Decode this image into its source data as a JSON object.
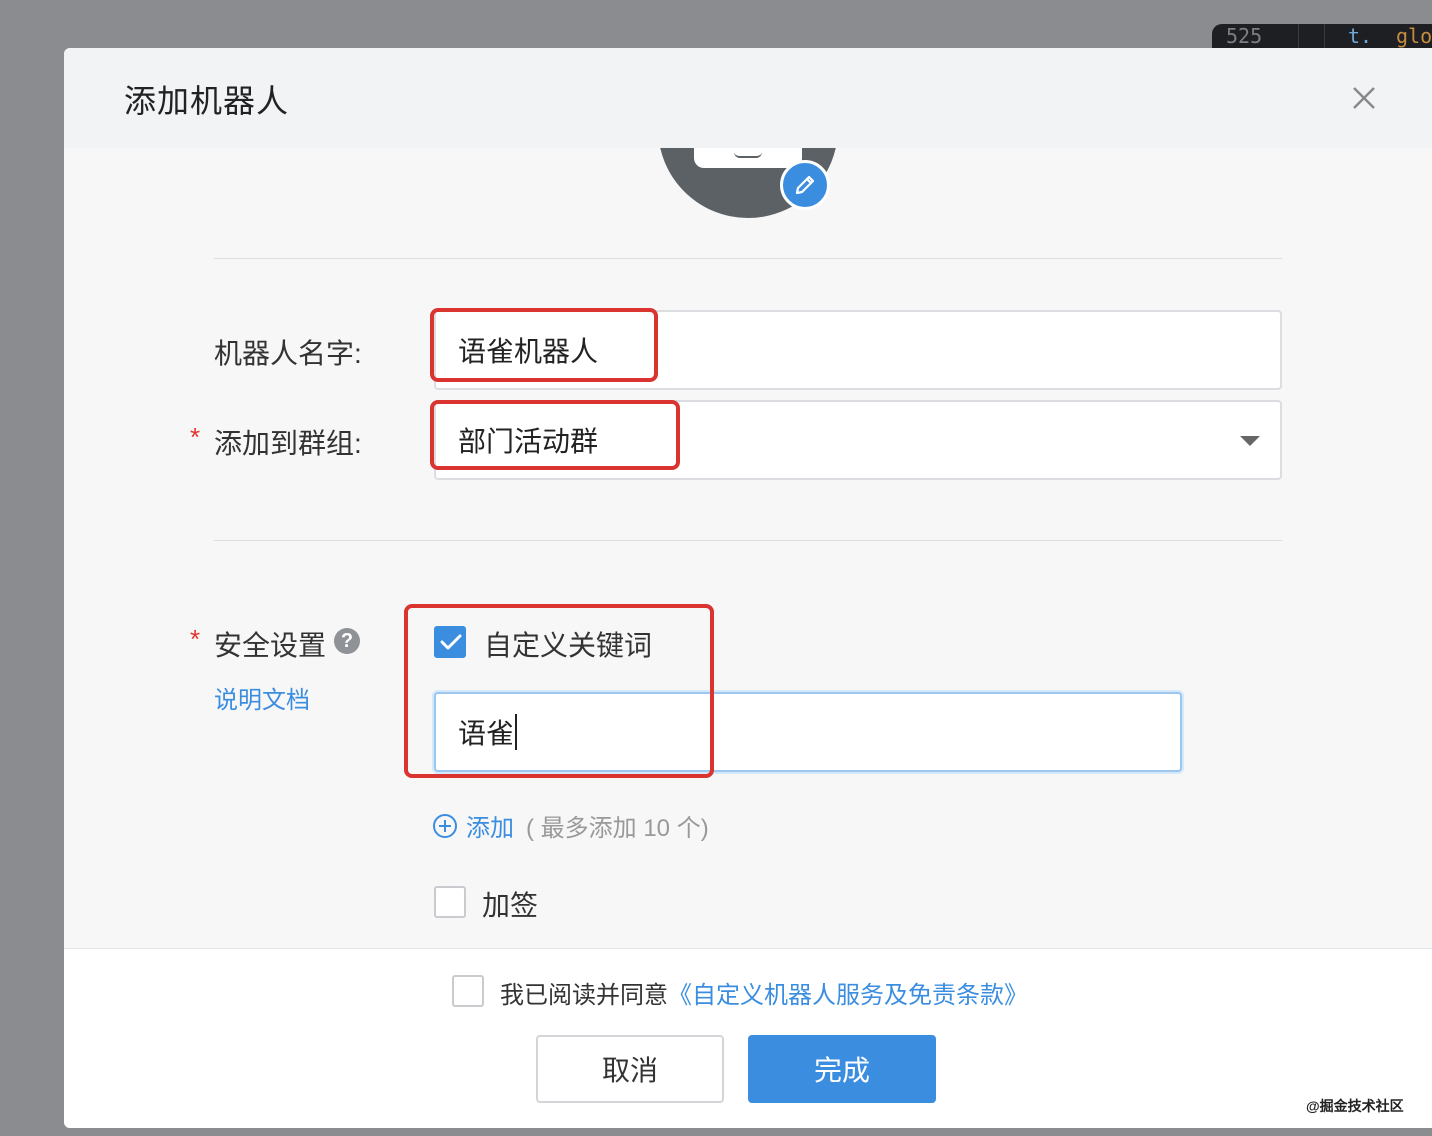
{
  "background_code": {
    "col1": "525",
    "col2": "t.",
    "col3": "glo"
  },
  "dialog": {
    "title": "添加机器人"
  },
  "form": {
    "name_label": "机器人名字:",
    "name_value": "语雀机器人",
    "group_label": "添加到群组:",
    "group_value": "部门活动群",
    "security_label": "安全设置",
    "doc_link": "说明文档",
    "keyword_option": "自定义关键词",
    "keyword_checked": true,
    "keyword_value": "语雀",
    "add_label": "添加",
    "add_note": "( 最多添加 10 个)",
    "sign_option": "加签",
    "sign_checked": false
  },
  "footer": {
    "agree_prefix": "我已阅读并同意",
    "agree_link": "《自定义机器人服务及免责条款》",
    "cancel_label": "取消",
    "confirm_label": "完成"
  },
  "watermark": "@掘金技术社区",
  "colors": {
    "accent": "#3b8de0",
    "annotation": "#d9342f",
    "required": "#e0342f"
  }
}
